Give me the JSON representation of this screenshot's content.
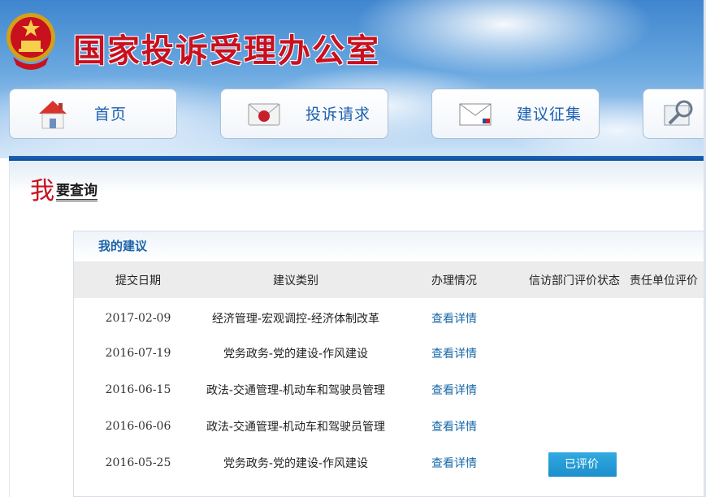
{
  "header": {
    "site_title": "国家投诉受理办公室"
  },
  "nav": [
    {
      "label": "首页",
      "icon": "house-icon"
    },
    {
      "label": "投诉请求",
      "icon": "sealed-envelope-icon"
    },
    {
      "label": "建议征集",
      "icon": "envelope-icon"
    },
    {
      "label": "",
      "icon": "magnifier-document-icon"
    }
  ],
  "query": {
    "big_char": "我",
    "rest": "要查询"
  },
  "panel": {
    "title": "我的建议",
    "columns": [
      "提交日期",
      "建议类别",
      "办理情况",
      "信访部门评价状态",
      "责任单位评价"
    ],
    "rows": [
      {
        "date": "2017-02-09",
        "category": "经济管理-宏观调控-经济体制改革",
        "status": "查看详情",
        "dept_eval": "",
        "unit_eval": ""
      },
      {
        "date": "2016-07-19",
        "category": "党务政务-党的建设-作风建设",
        "status": "查看详情",
        "dept_eval": "",
        "unit_eval": ""
      },
      {
        "date": "2016-06-15",
        "category": "政法-交通管理-机动车和驾驶员管理",
        "status": "查看详情",
        "dept_eval": "",
        "unit_eval": ""
      },
      {
        "date": "2016-06-06",
        "category": "政法-交通管理-机动车和驾驶员管理",
        "status": "查看详情",
        "dept_eval": "",
        "unit_eval": ""
      },
      {
        "date": "2016-05-25",
        "category": "党务政务-党的建设-作风建设",
        "status": "查看详情",
        "dept_eval": "已评价",
        "unit_eval": ""
      }
    ]
  },
  "colors": {
    "title_red": "#c8101e",
    "nav_blue": "#1c5fb0",
    "link_blue": "#1767a8",
    "bar_blue": "#1f63b5",
    "button_blue": "#1b8fcc"
  }
}
